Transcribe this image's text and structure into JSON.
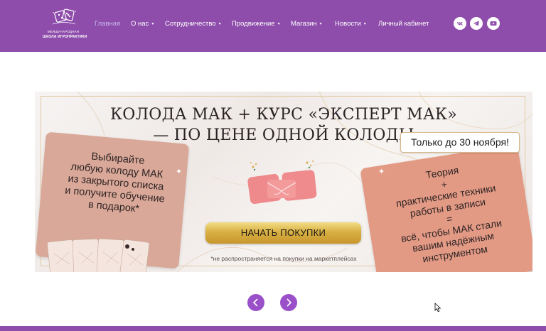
{
  "brand": {
    "logo_line1": "МЕЖДУНАРОДНАЯ",
    "logo_line2": "ШКОЛА ИГРОПРАКТИКИ",
    "header_color": "#8e4dab",
    "accent_color": "#9a50c8"
  },
  "nav": {
    "items": [
      {
        "label": "Главная",
        "active": true,
        "has_dropdown": false
      },
      {
        "label": "О нас",
        "active": false,
        "has_dropdown": true
      },
      {
        "label": "Сотрудничество",
        "active": false,
        "has_dropdown": true
      },
      {
        "label": "Продвижение",
        "active": false,
        "has_dropdown": true
      },
      {
        "label": "Магазин",
        "active": false,
        "has_dropdown": true
      },
      {
        "label": "Новости",
        "active": false,
        "has_dropdown": true
      },
      {
        "label": "Личный кабинет",
        "active": false,
        "has_dropdown": false
      }
    ],
    "dropdown_caret": "▾"
  },
  "social": [
    {
      "icon": "vk-icon"
    },
    {
      "icon": "telegram-icon"
    },
    {
      "icon": "youtube-icon"
    }
  ],
  "banner": {
    "headline_line1": "КОЛОДА МАК + КУРС «ЭКСПЕРТ МАК»",
    "headline_line2": "— ПО ЦЕНЕ ОДНОЙ КОЛОДЫ",
    "deadline": "Только до 30 ноября!",
    "left_card_lines": [
      "Выбирайте",
      "любую колоду МАК",
      "из закрытого списка",
      "и получите обучение",
      "в подарок*"
    ],
    "right_card_lines": [
      "Теория",
      "+",
      "практические техники",
      "работы в записи",
      "=",
      "всё, чтобы МАК стали",
      "вашим надёжным",
      "инструментом"
    ],
    "cta_label": "НАЧАТЬ ПОКУПКИ",
    "footnote": "*не распространяется на покупки на маркетплейсах"
  },
  "slider": {
    "prev_icon": "chevron-left-icon",
    "next_icon": "chevron-right-icon"
  }
}
